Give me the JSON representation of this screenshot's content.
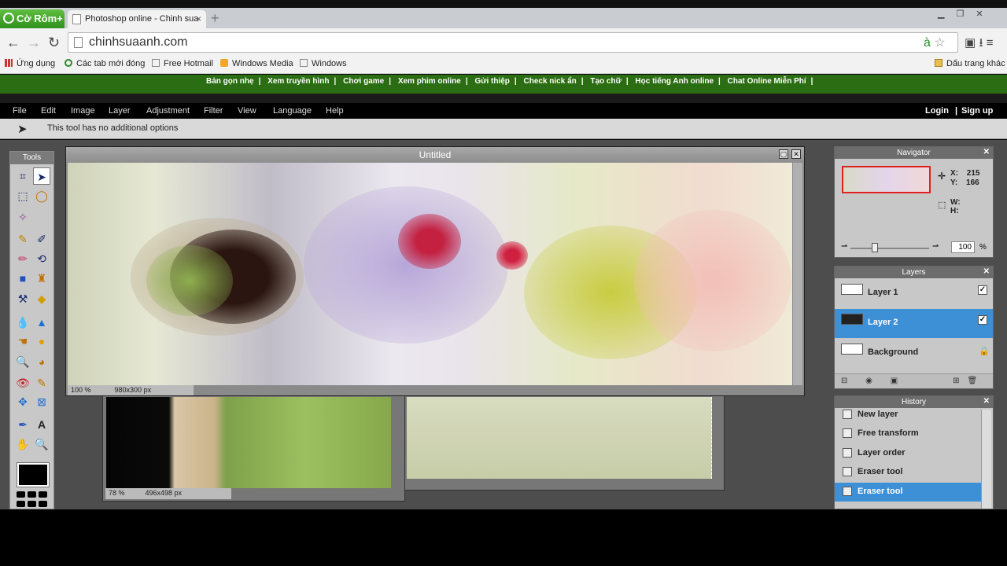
{
  "browser": {
    "brand": "Cờ Rôm+",
    "tab_title": "Photoshop online - Chinh sua",
    "url": "chinhsuaanh.com",
    "bookmarks": [
      {
        "label": "Ứng dụng"
      },
      {
        "label": "Các tab mới đóng"
      },
      {
        "label": "Free Hotmail"
      },
      {
        "label": "Windows Media"
      },
      {
        "label": "Windows"
      },
      {
        "label": "Dấu trang khác"
      }
    ]
  },
  "site_links": [
    "Bản gọn nhẹ",
    "Xem truyền hình",
    "Chơi game",
    "Xem phim online",
    "Gửi thiệp",
    "Check nick ẩn",
    "Tạo chữ",
    "Học tiếng Anh online",
    "Chat Online Miễn Phí"
  ],
  "menu": {
    "items": [
      "File",
      "Edit",
      "Image",
      "Layer",
      "Adjustment",
      "Filter",
      "View",
      "Language",
      "Help"
    ],
    "login": "Login",
    "separator": "|",
    "signup": "Sign up"
  },
  "options_bar": {
    "text": "This tool has no additional options"
  },
  "tools": {
    "title": "Tools"
  },
  "document_main": {
    "title": "Untitled",
    "zoom": "100 %",
    "size": "980x300 px"
  },
  "document_back": {
    "zoom": "78 %",
    "size": "496x498 px"
  },
  "navigator": {
    "title": "Navigator",
    "x_label": "X:",
    "x_value": "215",
    "y_label": "Y:",
    "y_value": "166",
    "w_label": "W:",
    "h_label": "H:",
    "zoom_value": "100",
    "zoom_unit": "%"
  },
  "layers": {
    "title": "Layers",
    "items": [
      {
        "name": "Layer 1",
        "visible": true
      },
      {
        "name": "Layer 2",
        "visible": true,
        "selected": true
      },
      {
        "name": "Background",
        "locked": true
      }
    ]
  },
  "history": {
    "title": "History",
    "items": [
      "New layer",
      "Free transform",
      "Layer order",
      "Eraser tool",
      "Eraser tool"
    ]
  },
  "colors": {
    "accent_selection": "#3d8fd6",
    "site_bar": "#2b6d12"
  }
}
